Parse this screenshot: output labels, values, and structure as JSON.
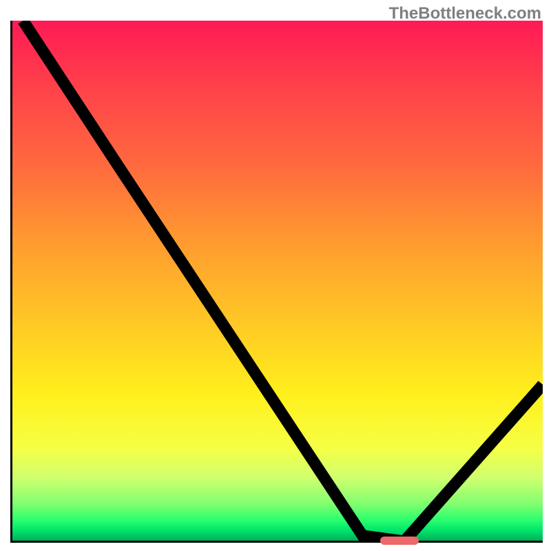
{
  "branding": "TheBottleneck.com",
  "colors": {
    "axis": "#000000",
    "marker": "#ed6869",
    "gradient_top": "#ff1a55",
    "gradient_bottom": "#00ae59"
  },
  "chart_data": {
    "type": "line",
    "title": "",
    "xlabel": "",
    "ylabel": "",
    "xlim": [
      0,
      100
    ],
    "ylim": [
      0,
      100
    ],
    "x": [
      2,
      20,
      66,
      73,
      74,
      100
    ],
    "values": [
      100,
      72,
      1,
      0,
      0,
      30
    ],
    "marker": {
      "x": 73,
      "y": 0,
      "label": "bottleneck-sweet-spot"
    },
    "notes": "Gradient background encodes vertical severity: red (high) to green (low). Black curve shows bottleneck percentage vs. an unlabeled horizontal parameter; minimum near x≈73."
  }
}
